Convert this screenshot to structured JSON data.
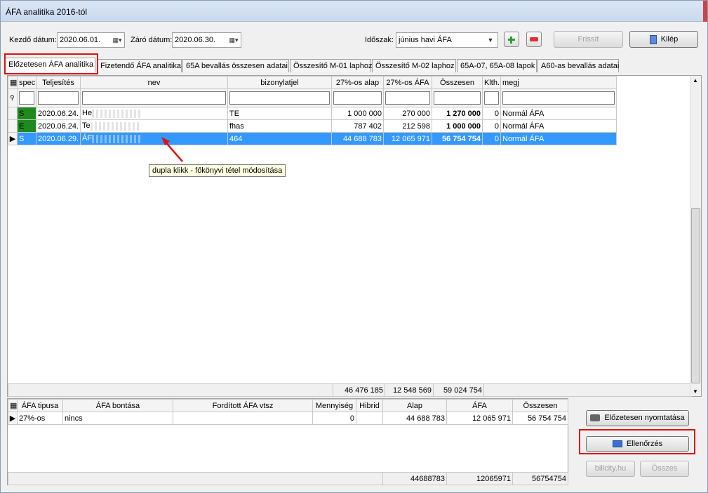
{
  "window": {
    "title": "ÁFA analitika 2016-tól"
  },
  "toolbar": {
    "start_label": "Kezdő dátum:",
    "start_value": "2020.06.01.",
    "end_label": "Záró dátum:",
    "end_value": "2020.06.30.",
    "period_label": "Időszak:",
    "period_value": "június havi ÁFA",
    "refresh_label": "Frissít",
    "exit_label": "Kilép"
  },
  "tabs": [
    "Előzetesen ÁFA analitika",
    "Fizetendő ÁFA analitika",
    "65A bevallás összesen adatai",
    "Összesítő M-01 laphoz",
    "Összesítő M-02 laphoz",
    "65A-07, 65A-08 lapok",
    "A60-as bevallás adatai"
  ],
  "grid": {
    "headers": [
      "spec",
      "Teljesítés",
      "nev",
      "bizonylatjel",
      "27%-os alap",
      "27%-os ÁFA",
      "Összesen",
      "Klth.",
      "megj"
    ],
    "rows": [
      {
        "spec": "S",
        "date": "2020.06.24.",
        "nev": "He",
        "biz": "TE",
        "alap": "1 000 000",
        "afa": "270 000",
        "ossz": "1 270 000",
        "klth": "0",
        "megj": "Normál ÁFA"
      },
      {
        "spec": "E",
        "date": "2020.06.24.",
        "nev": "Te",
        "biz": "fhas",
        "alap": "787 402",
        "afa": "212 598",
        "ossz": "1 000 000",
        "klth": "0",
        "megj": "Normál ÁFA"
      },
      {
        "spec": "S",
        "date": "2020.06.29.",
        "nev": "ÁF",
        "biz": "464",
        "alap": "44 688 783",
        "afa": "12 065 971",
        "ossz": "56 754 754",
        "klth": "0",
        "megj": "Normál ÁFA"
      }
    ],
    "totals": {
      "alap": "46 476 185",
      "afa": "12 548 569",
      "ossz": "59 024 754"
    }
  },
  "tooltip": "dupla klikk - főkönyvi tétel módosítása",
  "summary": {
    "headers": [
      "ÁFA tipusa",
      "ÁFA bontása",
      "Fordított ÁFA vtsz",
      "Mennyiség",
      "Hibrid",
      "Alap",
      "ÁFA",
      "Összesen"
    ],
    "row": {
      "tipus": "27%-os",
      "bontas": "nincs",
      "ford": "",
      "menny": "0",
      "hibrid": "",
      "alap": "44 688 783",
      "afa": "12 065 971",
      "ossz": "56 754 754"
    },
    "totals": {
      "alap": "44688783",
      "afa": "12065971",
      "ossz": "56754754"
    }
  },
  "side_buttons": {
    "print": "Előzetesen nyomtatása",
    "check": "Ellenőrzés",
    "billcity": "billcity.hu",
    "all": "Összes"
  }
}
